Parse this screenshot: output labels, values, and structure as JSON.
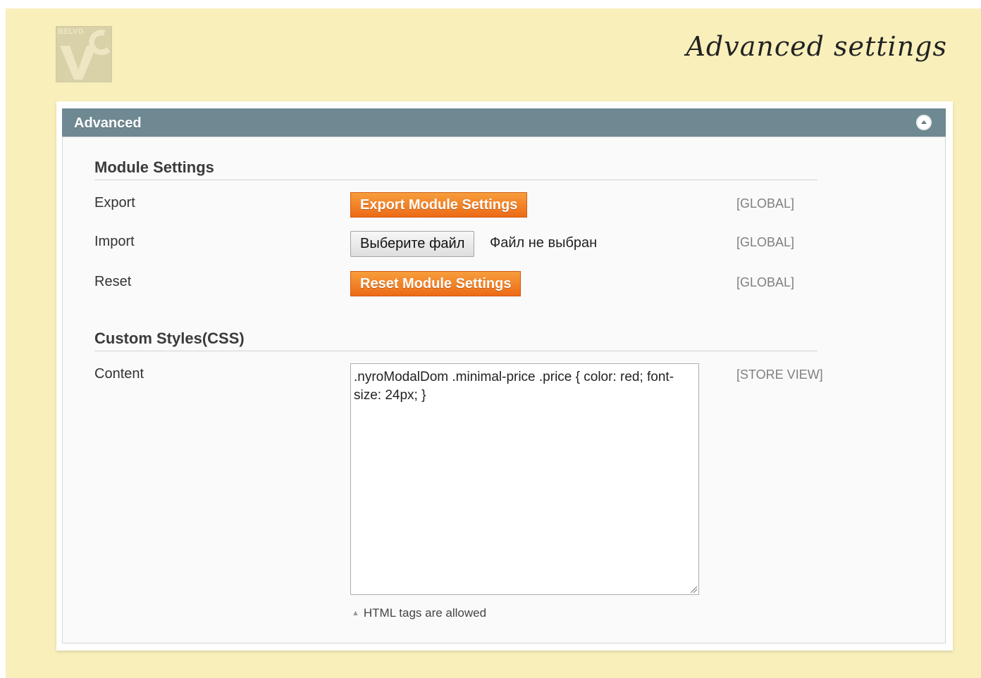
{
  "header": {
    "logo_text": "BELVG",
    "page_title": "Advanced settings"
  },
  "panel": {
    "title": "Advanced",
    "collapse_icon": "collapse-up-icon"
  },
  "module_settings": {
    "title": "Module Settings",
    "rows": [
      {
        "label": "Export",
        "control": "Export Module Settings",
        "scope": "[GLOBAL]"
      },
      {
        "label": "Import",
        "control": "Выберите файл",
        "status": "Файл не выбран",
        "scope": "[GLOBAL]"
      },
      {
        "label": "Reset",
        "control": "Reset Module Settings",
        "scope": "[GLOBAL]"
      }
    ]
  },
  "custom_styles": {
    "title": "Custom Styles(CSS)",
    "content_label": "Content",
    "content_value": ".nyroModalDom .minimal-price .price { color: red; font-size: 24px; }",
    "scope": "[STORE VIEW]",
    "note": "HTML tags are allowed"
  },
  "colors": {
    "page_background": "#f8efba",
    "header_bar": "#6f8992",
    "button_orange": "#ed6a16"
  }
}
